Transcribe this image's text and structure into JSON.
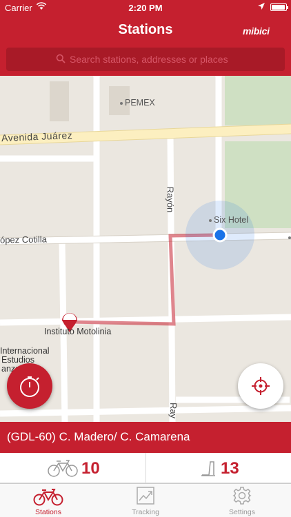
{
  "status_bar": {
    "carrier": "Carrier",
    "time": "2:20 PM",
    "battery_level": 0.95
  },
  "header": {
    "title": "Stations",
    "brand": "mibici"
  },
  "search": {
    "placeholder": "Search stations, addresses or places"
  },
  "map": {
    "streets": {
      "avenida_juarez": "Avenida Juárez",
      "lopez_cotilla": "ópez Cotilla",
      "rayon": "Rayón",
      "rayon_bottom": "Ray"
    },
    "places": {
      "pemex": "PEMEX",
      "six_hotel": "Six Hotel",
      "instituto": "Instituto Motolinia",
      "internacional_1": "Internacional",
      "internacional_2": "Estudios",
      "internacional_3": "anza"
    },
    "route_color": "#c5202f",
    "user_color": "#1a73e8"
  },
  "station": {
    "name": "(GDL-60) C. Madero/ C. Camarena",
    "bikes_available": "10",
    "docks_available": "13"
  },
  "tabs": [
    {
      "label": "Stations",
      "icon": "bicycle-icon",
      "active": true
    },
    {
      "label": "Tracking",
      "icon": "chart-icon",
      "active": false
    },
    {
      "label": "Settings",
      "icon": "gear-icon",
      "active": false
    }
  ],
  "colors": {
    "accent": "#c5202f",
    "search_bg": "#a81a27",
    "map_bg": "#ebe7e0",
    "park": "#cfe0c3",
    "avenue": "#fcefc0"
  }
}
